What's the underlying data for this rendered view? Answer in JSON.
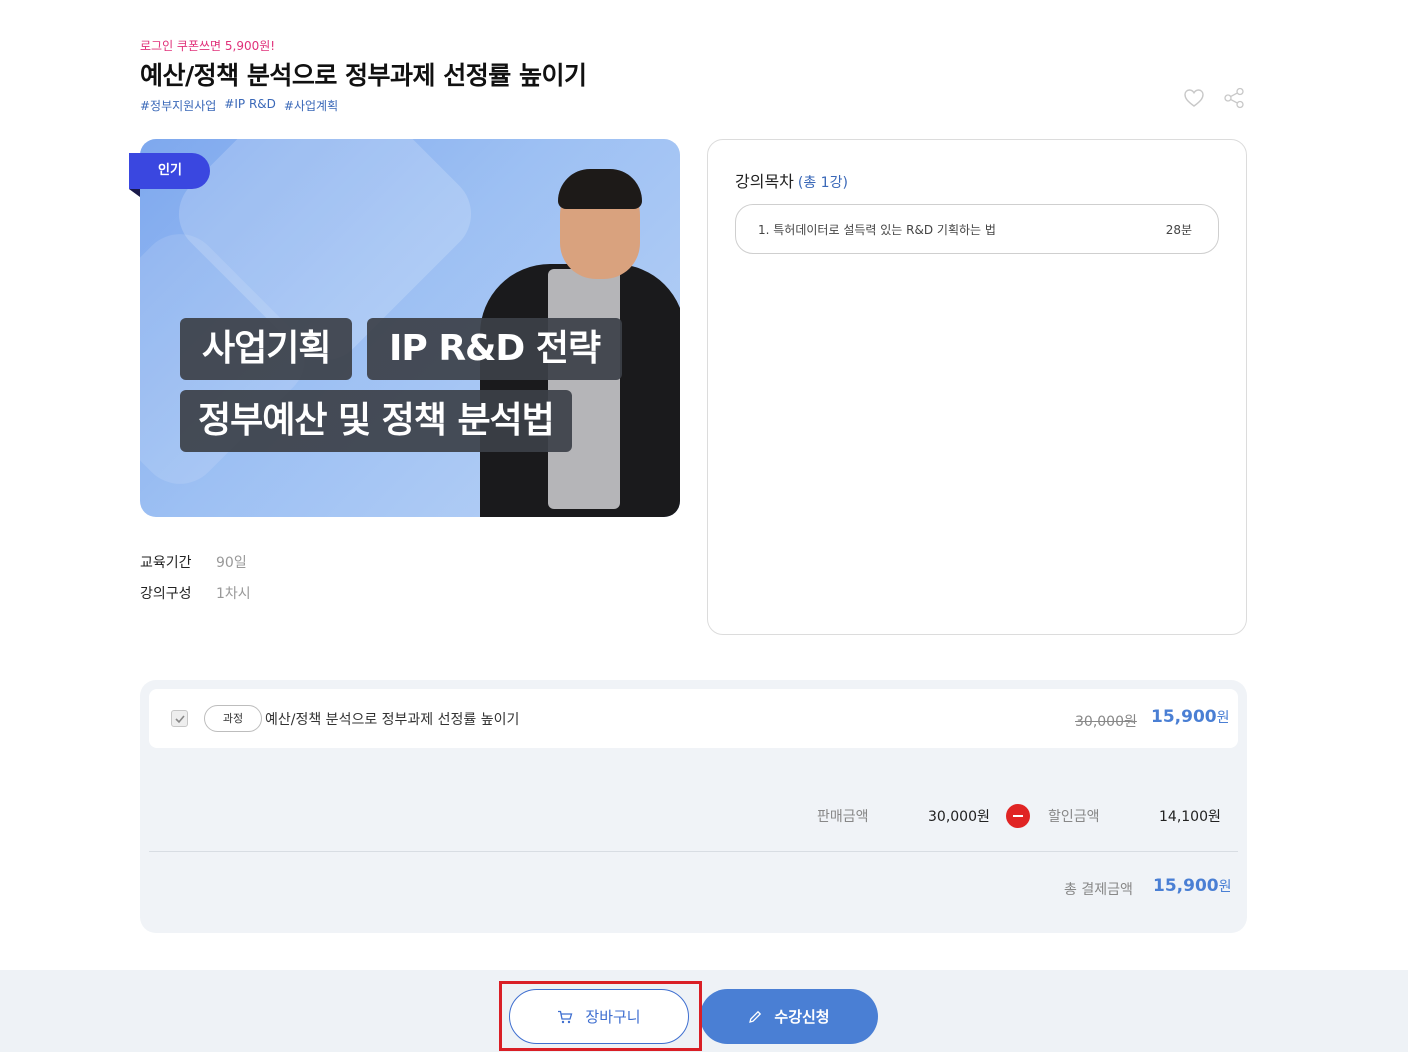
{
  "header": {
    "promo": "로그인 쿠폰쓰면 5,900원!",
    "title": "예산/정책 분석으로 정부과제 선정률 높이기",
    "tags": [
      "#정부지원사업",
      "#IP R&D",
      "#사업계획"
    ]
  },
  "thumbnail": {
    "badge": "인기",
    "overlay": [
      "사업기획",
      "IP R&D 전략",
      "정부예산 및 정책 분석법"
    ]
  },
  "info": [
    {
      "label": "교육기간",
      "value": "90일"
    },
    {
      "label": "강의구성",
      "value": "1차시"
    }
  ],
  "toc": {
    "title": "강의목차",
    "count": "(총 1강)",
    "items": [
      {
        "title": "1. 특허데이터로 설득력 있는 R&D 기획하는 법",
        "duration": "28분"
      }
    ]
  },
  "order": {
    "chip": "과정",
    "course_name": "예산/정책 분석으로 정부과제 선정률 높이기",
    "original_price": "30,000원",
    "sale_price": "15,900",
    "won": "원",
    "sale_label": "판매금액",
    "sale_value": "30,000원",
    "discount_label": "할인금액",
    "discount_value": "14,100원",
    "total_label": "총 결제금액",
    "total_value": "15,900"
  },
  "buttons": {
    "cart": "장바구니",
    "enroll": "수강신청"
  },
  "colors": {
    "accent": "#4a7fd4",
    "promo": "#e0317a",
    "badge": "#3a47e0",
    "minus": "#e02424",
    "highlight": "#d91f26"
  }
}
